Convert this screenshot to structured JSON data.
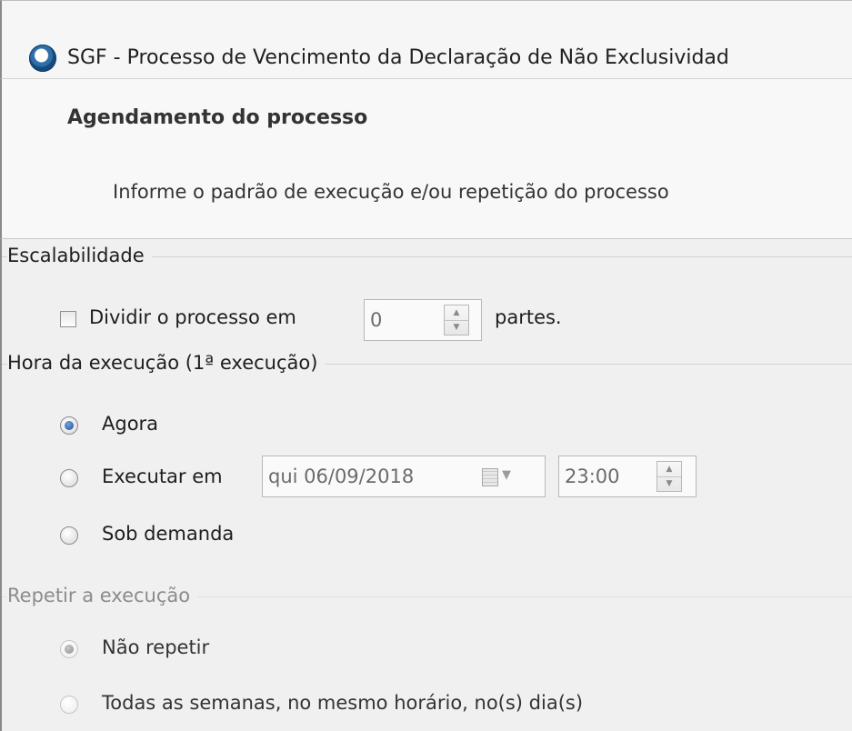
{
  "window": {
    "title": "SGF - Processo de Vencimento da Declaração de Não Exclusividad",
    "icon": "app-logo-icon"
  },
  "header": {
    "title": "Agendamento do processo",
    "subtitle": "Informe o padrão de execução e/ou repetição do processo"
  },
  "scalability": {
    "group_label": "Escalabilidade",
    "checkbox_label": "Dividir o processo em",
    "checked": false,
    "parts_value": "0",
    "suffix": "partes."
  },
  "execution_time": {
    "group_label": "Hora da execução (1ª execução)",
    "options": [
      {
        "label": "Agora",
        "selected": true
      },
      {
        "label": "Executar em",
        "selected": false
      },
      {
        "label": "Sob demanda",
        "selected": false
      }
    ],
    "date_value": "qui  06/09/2018",
    "time_value": "23:00"
  },
  "repeat": {
    "group_label": "Repetir a execução",
    "options": [
      {
        "label": "Não repetir",
        "selected": true
      },
      {
        "label": "Todas as semanas, no mesmo horário, no(s) dia(s)",
        "selected": false
      }
    ]
  },
  "colors": {
    "window_border": "#8a8a8a",
    "radio_selected": "#1c4f92",
    "disabled_text": "#8c8c8c"
  }
}
